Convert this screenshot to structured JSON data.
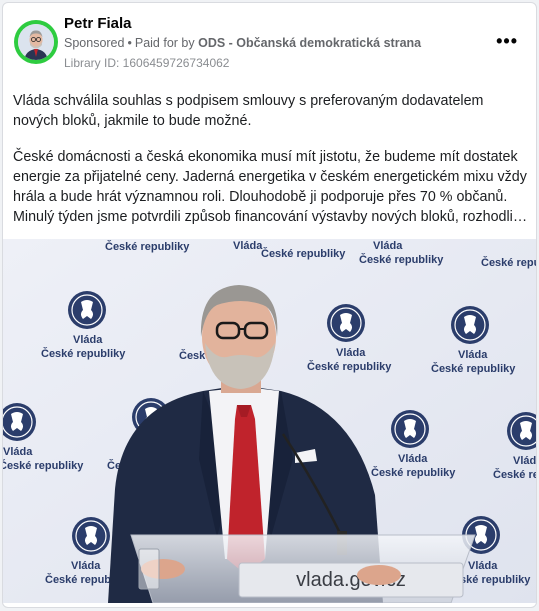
{
  "post": {
    "author": "Petr Fiala",
    "sponsored": "Sponsored",
    "paid_for_by_prefix": "Paid for by",
    "paid_for_by_org": "ODS - Občanská demokratická strana",
    "library_id": "Library ID: 1606459726734062",
    "more_icon": "more-options-icon",
    "paragraph1": "Vláda schválila souhlas s podpisem smlouvy s preferovaným dodavatelem nových bloků, jakmile to bude možné.",
    "paragraph2": "České domácnosti a česká ekonomika musí mít jistotu, že budeme mít dostatek energie za přijatelné ceny. Jaderná energetika v českém energetickém mixu vždy hrála a bude hrát významnou roli. Dlouhodobě ji podporuje přes 70 % občanů. Minulý týden jsme potvrdili způsob financování výstavby nových bloků, rozhodli…"
  },
  "image": {
    "backdrop_line1": "Vláda",
    "backdrop_line2": "České republiky",
    "lectern_text": "vlada.gov.cz"
  },
  "colors": {
    "avatar_ring": "#2ecc40",
    "tie": "#c0232c",
    "suit": "#1f2a44",
    "backdrop_logo": "#2b3d6b"
  }
}
